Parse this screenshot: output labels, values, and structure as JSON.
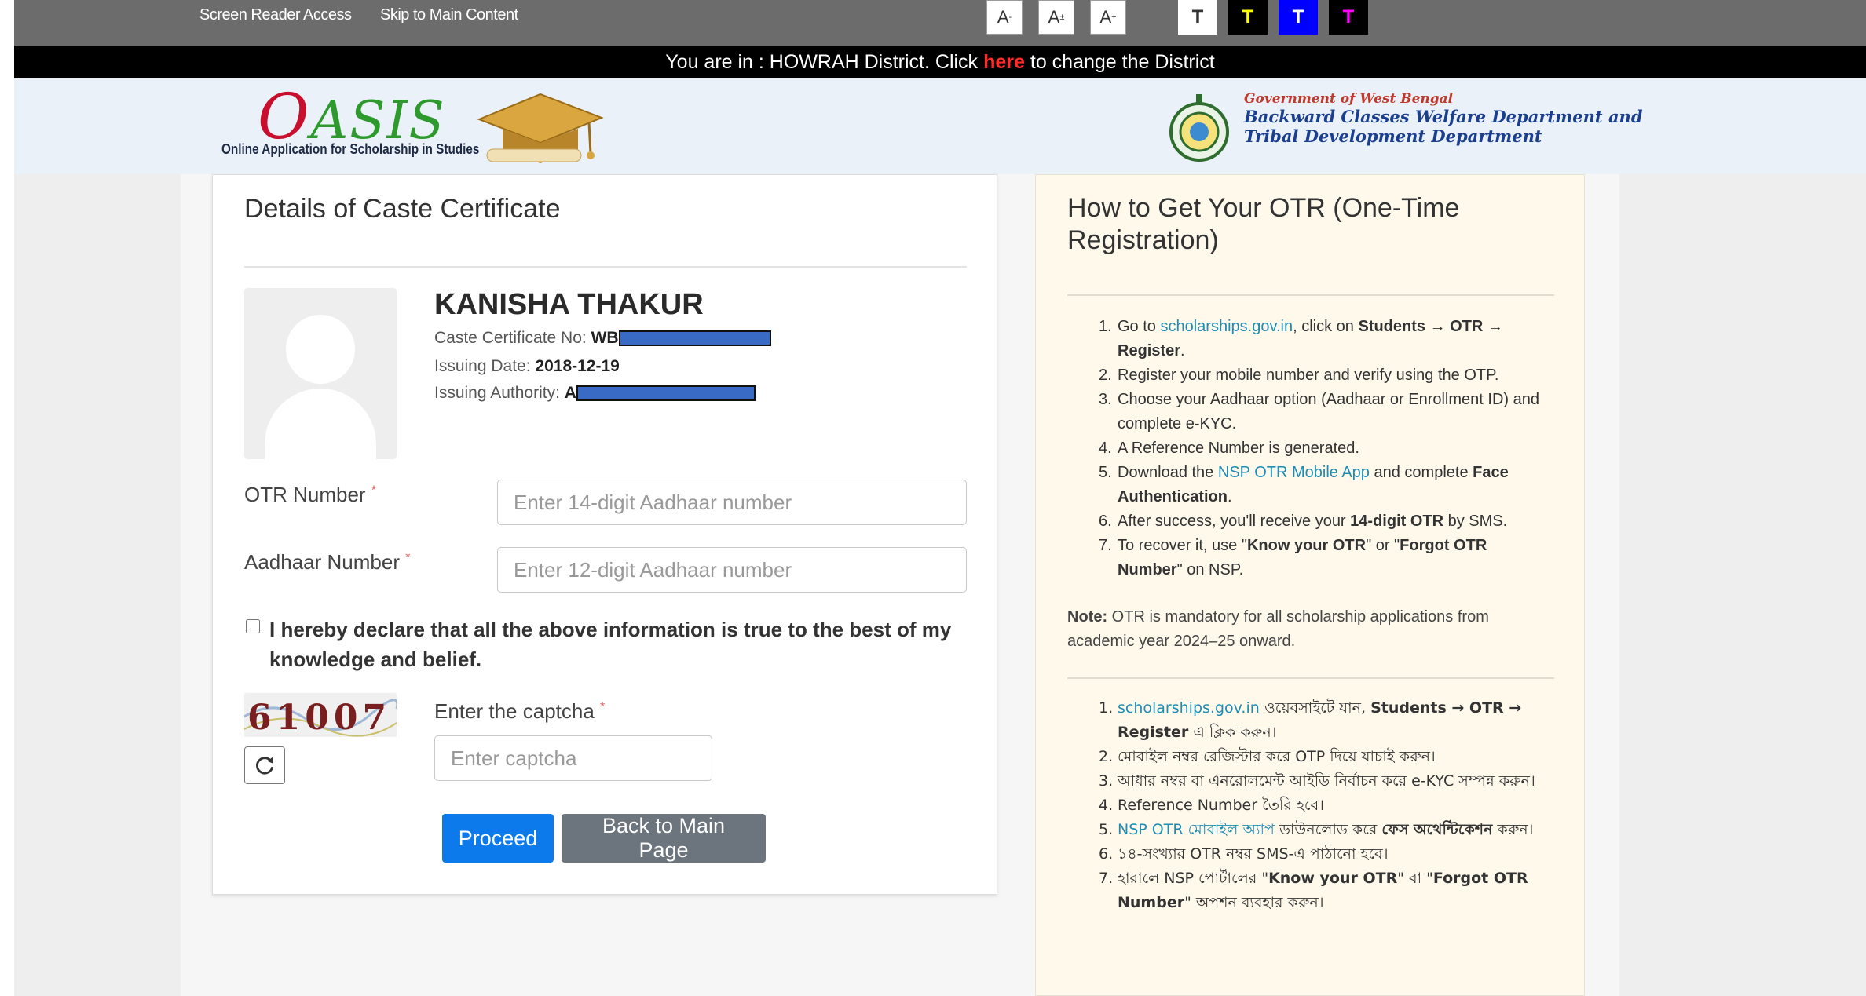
{
  "topbar": {
    "screen_reader": "Screen Reader Access",
    "skip_main": "Skip to Main Content",
    "font_decrease": "A",
    "font_decrease_sup": "-",
    "font_normal": "A",
    "font_normal_sup": "±",
    "font_increase": "A",
    "font_increase_sup": "+",
    "themes": [
      {
        "label": "T",
        "bg": "#ffffff",
        "fg": "#333333"
      },
      {
        "label": "T",
        "bg": "#000000",
        "fg": "#ffff00"
      },
      {
        "label": "T",
        "bg": "#0000ff",
        "fg": "#ffffff"
      },
      {
        "label": "T",
        "bg": "#000000",
        "fg": "#ff00ff"
      }
    ]
  },
  "district_bar": {
    "prefix": "You are in : HOWRAH District. Click",
    "link": "here",
    "suffix": "to change the District"
  },
  "header": {
    "logo_text": "OASIS",
    "logo_tagline": "Online Application for Scholarship in Studies",
    "gov_line": "Government of West Bengal",
    "dept_line": "Backward Classes Welfare Department and Tribal Development Department"
  },
  "card": {
    "title": "Details of Caste Certificate",
    "student_name": "KANISHA THAKUR",
    "cert_no_label": "Caste Certificate No:",
    "cert_no_value": "WB",
    "issue_date_label": "Issuing Date:",
    "issue_date_value": "2018-12-19",
    "authority_label": "Issuing Authority:",
    "authority_value": "A",
    "otr_label": "OTR Number",
    "otr_placeholder": "Enter 14-digit Aadhaar number",
    "aadhaar_label": "Aadhaar Number",
    "aadhaar_placeholder": "Enter 12-digit Aadhaar number",
    "required_mark": "*",
    "declaration": "I hereby declare that all the above information is true to the best of my knowledge and belief.",
    "captcha_text": "61007",
    "captcha_label": "Enter the captcha",
    "captcha_placeholder": "Enter captcha",
    "proceed": "Proceed",
    "back": "Back to Main Page"
  },
  "panel": {
    "title": "How to Get Your OTR (One-Time Registration)",
    "steps_en": {
      "s1_pre": "Go to",
      "s1_link": "scholarships.gov.in",
      "s1_mid": ", click on",
      "s1_bold": "Students → OTR → Register",
      "s1_end": ".",
      "s2": "Register your mobile number and verify using the OTP.",
      "s3": "Choose your Aadhaar option (Aadhaar or Enrollment ID) and complete e-KYC.",
      "s4": "A Reference Number is generated.",
      "s5_pre": "Download the",
      "s5_link": "NSP OTR Mobile App",
      "s5_mid": "and complete",
      "s5_bold": "Face Authentication",
      "s5_end": ".",
      "s6_pre": "After success, you'll receive your",
      "s6_bold": "14-digit OTR",
      "s6_end": "by SMS.",
      "s7_pre": "To recover it, use \"",
      "s7_bold1": "Know your OTR",
      "s7_mid": "\" or \"",
      "s7_bold2": "Forgot OTR Number",
      "s7_end": "\" on NSP."
    },
    "note_label": "Note:",
    "note_text": "OTR is mandatory for all scholarship applications from academic year 2024–25 onward.",
    "steps_bn": {
      "s1_link": "scholarships.gov.in",
      "s1_mid": "ওয়েবসাইটে যান,",
      "s1_bold": "Students → OTR → Register",
      "s1_end": "এ ক্লিক করুন।",
      "s2": "মোবাইল নম্বর রেজিস্টার করে OTP দিয়ে যাচাই করুন।",
      "s3": "আধার নম্বর বা এনরোলমেন্ট আইডি নির্বাচন করে e-KYC সম্পন্ন করুন।",
      "s4": "Reference Number তৈরি হবে।",
      "s5_link": "NSP OTR মোবাইল অ্যাপ",
      "s5_mid": "ডাউনলোড করে",
      "s5_bold": "ফেস অথেন্টিকেশন",
      "s5_end": "করুন।",
      "s6": "১৪-সংখ্যার OTR নম্বর SMS-এ পাঠানো হবে।",
      "s7_pre": "হারালে NSP পোর্টালের \"",
      "s7_bold1": "Know your OTR",
      "s7_mid": "\" বা \"",
      "s7_bold2": "Forgot OTR Number",
      "s7_end": "\" অপশন ব্যবহার করুন।"
    },
    "numbers": [
      "1.",
      "2.",
      "3.",
      "4.",
      "5.",
      "6.",
      "7."
    ]
  },
  "colors": {
    "primary": "#0d7aec",
    "secondary": "#6c757d",
    "district_link": "#ff2b2b",
    "panel_bg": "#fff9ec",
    "link": "#1e8db4"
  }
}
